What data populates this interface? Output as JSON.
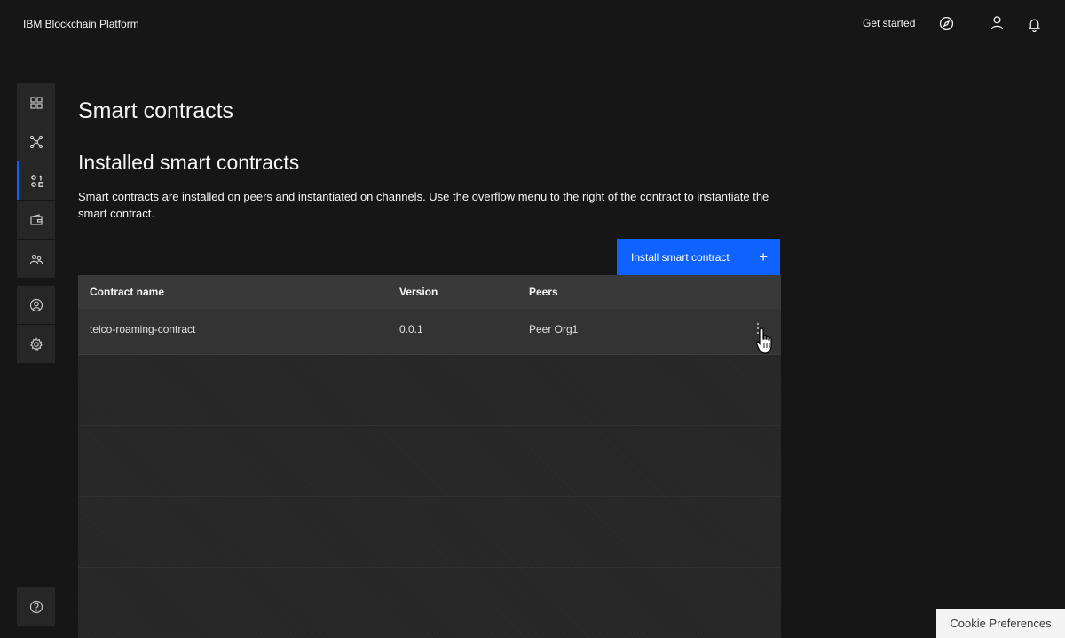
{
  "header": {
    "brand": "IBM Blockchain Platform",
    "get_started": "Get started",
    "icons": [
      "compass-icon",
      "user-icon",
      "notification-icon"
    ]
  },
  "sidebar": {
    "items": [
      {
        "icon": "dashboard-grid-icon"
      },
      {
        "icon": "network-icon"
      },
      {
        "icon": "smart-contracts-icon",
        "active": true
      },
      {
        "icon": "wallet-icon"
      },
      {
        "icon": "organizations-icon"
      },
      {
        "icon": "user-profile-icon"
      },
      {
        "icon": "settings-icon"
      },
      {
        "icon": "help-icon"
      }
    ]
  },
  "main": {
    "page_title": "Smart contracts",
    "section_title": "Installed smart contracts",
    "description": "Smart contracts are installed on peers and instantiated on channels. Use the overflow menu to the right of the contract to instantiate the smart contract.",
    "install_button_label": "Install smart contract",
    "table": {
      "columns": [
        "Contract name",
        "Version",
        "Peers"
      ],
      "rows": [
        {
          "contract_name": "telco-roaming-contract",
          "version": "0.0.1",
          "peers": "Peer Org1"
        }
      ]
    }
  },
  "cookie": {
    "label": "Cookie Preferences"
  },
  "colors": {
    "background": "#161616",
    "accent": "#0f62fe",
    "panel": "#262626",
    "table_header": "#393939"
  }
}
